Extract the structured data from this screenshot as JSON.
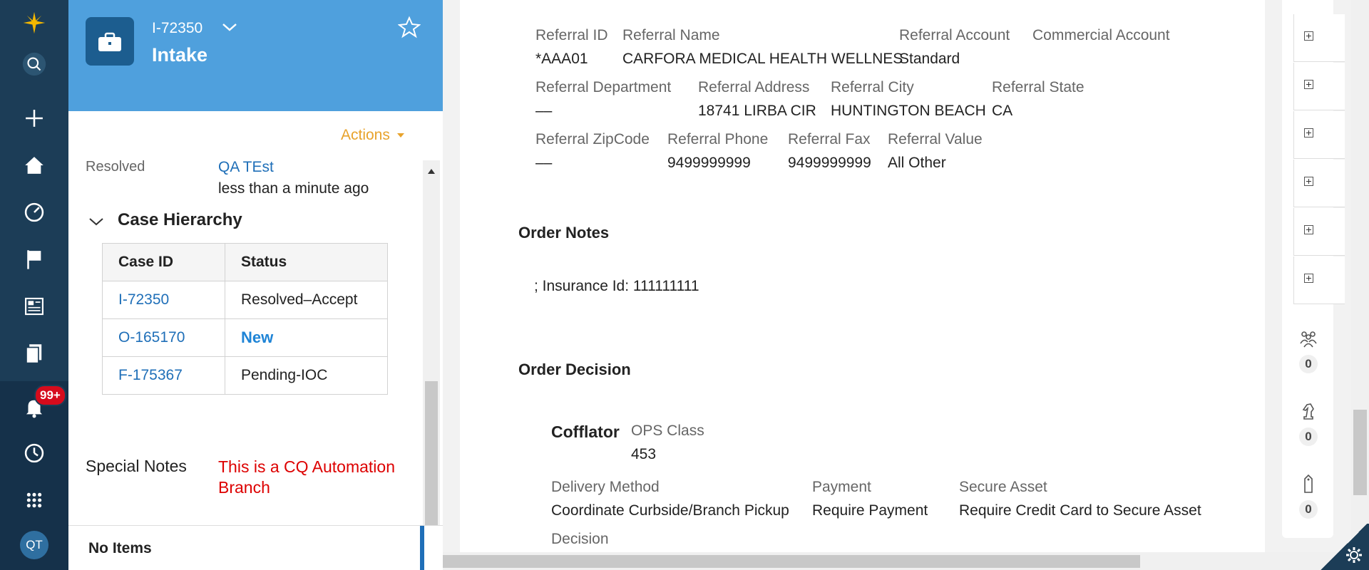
{
  "case": {
    "id": "I-72350",
    "type": "Intake",
    "actions_label": "Actions"
  },
  "nav": {
    "notifications_badge": "99+",
    "avatar_initials": "QT"
  },
  "history": {
    "status_label": "Resolved",
    "by": "QA TEst",
    "when": "less than a minute ago"
  },
  "hierarchy": {
    "title": "Case Hierarchy",
    "columns": [
      "Case ID",
      "Status"
    ],
    "rows": [
      {
        "id": "I-72350",
        "status": "Resolved–Accept"
      },
      {
        "id": "O-165170",
        "status": "New"
      },
      {
        "id": "F-175367",
        "status": "Pending-IOC"
      }
    ]
  },
  "special_notes": {
    "label": "Special Notes",
    "value": "This is a CQ Automation Branch"
  },
  "no_items": "No Items",
  "referral": {
    "id_label": "Referral ID",
    "id": "*AAA01",
    "name_label": "Referral Name",
    "name": "CARFORA MEDICAL HEALTH WELLNES",
    "account_label": "Referral Account",
    "account": "Standard",
    "commercial_label": "Commercial Account",
    "commercial": "",
    "dept_label": "Referral Department",
    "dept": "––",
    "address_label": "Referral Address",
    "address": "18741 LIRBA CIR",
    "city_label": "Referral City",
    "city": "HUNTINGTON BEACH",
    "state_label": "Referral State",
    "state": "CA",
    "zip_label": "Referral ZipCode",
    "zip": "––",
    "phone_label": "Referral Phone",
    "phone": "9499999999",
    "fax_label": "Referral Fax",
    "fax": "9499999999",
    "value_label": "Referral Value",
    "value": "All Other"
  },
  "order_notes": {
    "title": "Order Notes",
    "text": "; Insurance Id: 111111111"
  },
  "order_decision": {
    "title": "Order Decision",
    "item": "Cofflator",
    "ops_label": "OPS Class",
    "ops": "453",
    "delivery_label": "Delivery Method",
    "delivery": "Coordinate Curbside/Branch Pickup",
    "payment_label": "Payment",
    "payment": "Require Payment",
    "secure_label": "Secure Asset",
    "secure": "Require Credit Card to Secure Asset",
    "decision_label": "Decision"
  },
  "utility": {
    "followers_count": "0",
    "tasks_count": "0",
    "tags_count": "0"
  },
  "colors": {
    "nav": "#1c3d57",
    "header": "#4fa0dd",
    "link": "#1f6fb8",
    "actions": "#e8a32c",
    "special_notes": "#dd0000"
  }
}
